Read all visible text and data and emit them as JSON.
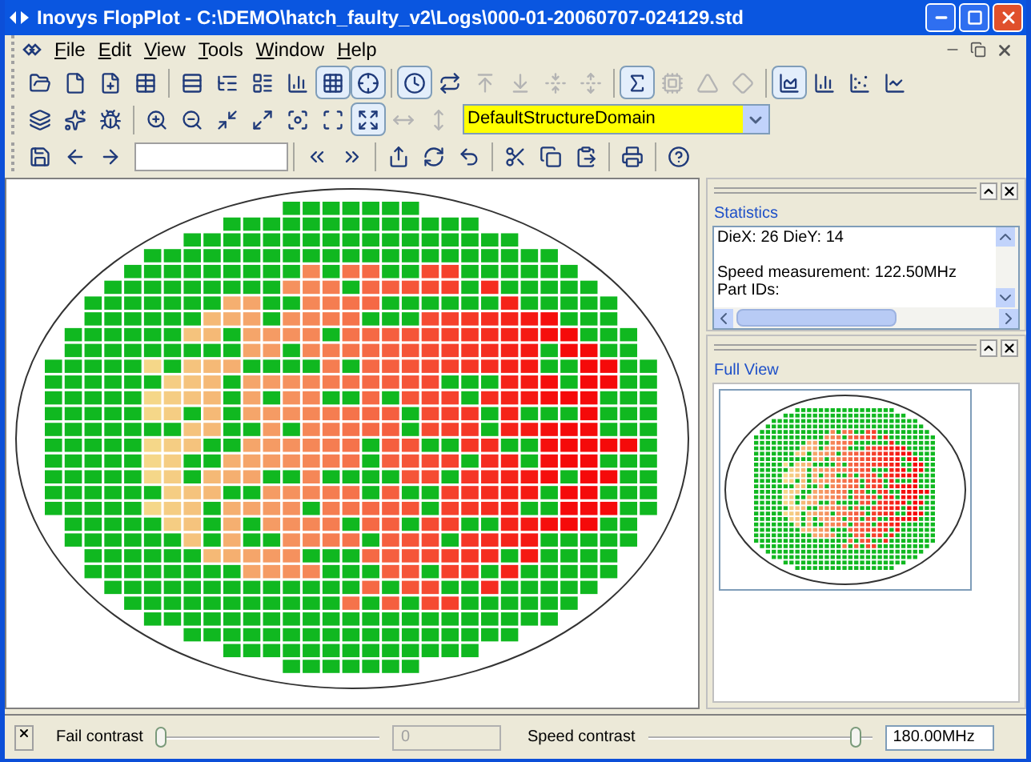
{
  "window": {
    "title": "Inovys FlopPlot - C:\\DEMO\\hatch_faulty_v2\\Logs\\000-01-20060707-024129.std"
  },
  "menu": [
    "File",
    "Edit",
    "View",
    "Tools",
    "Window",
    "Help"
  ],
  "toolbars": [
    {
      "groups": [
        [
          {
            "kind": "open",
            "pressed": false,
            "disabled": false
          },
          {
            "kind": "new",
            "pressed": false,
            "disabled": false
          },
          {
            "kind": "import",
            "pressed": false,
            "disabled": false
          },
          {
            "kind": "table",
            "pressed": false,
            "disabled": false
          }
        ],
        [
          {
            "kind": "rows",
            "pressed": false,
            "disabled": false
          },
          {
            "kind": "tree",
            "pressed": false,
            "disabled": false
          },
          {
            "kind": "list",
            "pressed": false,
            "disabled": false
          },
          {
            "kind": "bars",
            "pressed": false,
            "disabled": false
          },
          {
            "kind": "grid",
            "pressed": true,
            "disabled": false
          },
          {
            "kind": "mark",
            "pressed": true,
            "disabled": false
          }
        ],
        [
          {
            "kind": "clock",
            "pressed": true,
            "disabled": false
          },
          {
            "kind": "swap",
            "pressed": false,
            "disabled": false
          },
          {
            "kind": "top",
            "pressed": false,
            "disabled": true
          },
          {
            "kind": "bottom",
            "pressed": false,
            "disabled": true
          },
          {
            "kind": "center",
            "pressed": false,
            "disabled": true
          },
          {
            "kind": "spread",
            "pressed": false,
            "disabled": true
          }
        ],
        [
          {
            "kind": "sum",
            "pressed": true,
            "disabled": false
          },
          {
            "kind": "chip",
            "pressed": false,
            "disabled": true
          },
          {
            "kind": "triangle",
            "pressed": false,
            "disabled": true
          },
          {
            "kind": "diamond",
            "pressed": false,
            "disabled": true
          }
        ],
        [
          {
            "kind": "area",
            "pressed": true,
            "disabled": false
          },
          {
            "kind": "columns",
            "pressed": false,
            "disabled": false
          },
          {
            "kind": "scatter",
            "pressed": false,
            "disabled": false
          },
          {
            "kind": "line",
            "pressed": false,
            "disabled": false
          }
        ]
      ]
    },
    {
      "groups": [
        [
          {
            "kind": "layers",
            "pressed": false,
            "disabled": false
          },
          {
            "kind": "sparkle",
            "pressed": false,
            "disabled": false
          },
          {
            "kind": "bug",
            "pressed": false,
            "disabled": false
          }
        ],
        [
          {
            "kind": "zoomin",
            "pressed": false,
            "disabled": false
          },
          {
            "kind": "zoomout",
            "pressed": false,
            "disabled": false
          },
          {
            "kind": "shrink",
            "pressed": false,
            "disabled": false
          },
          {
            "kind": "expand",
            "pressed": false,
            "disabled": false
          },
          {
            "kind": "focus",
            "pressed": false,
            "disabled": false
          },
          {
            "kind": "fit",
            "pressed": false,
            "disabled": false
          },
          {
            "kind": "frame",
            "pressed": true,
            "disabled": false
          },
          {
            "kind": "width",
            "pressed": false,
            "disabled": true
          },
          {
            "kind": "height",
            "pressed": false,
            "disabled": true
          }
        ]
      ]
    },
    {
      "groups": [
        [
          {
            "kind": "save",
            "pressed": false,
            "disabled": false
          },
          {
            "kind": "back",
            "pressed": false,
            "disabled": false
          },
          {
            "kind": "forward",
            "pressed": false,
            "disabled": false
          }
        ],
        [
          {
            "kind": "prev",
            "pressed": false,
            "disabled": false
          },
          {
            "kind": "next",
            "pressed": false,
            "disabled": false
          }
        ],
        [
          {
            "kind": "export",
            "pressed": false,
            "disabled": false
          },
          {
            "kind": "refresh",
            "pressed": false,
            "disabled": false
          },
          {
            "kind": "undo",
            "pressed": false,
            "disabled": false
          }
        ],
        [
          {
            "kind": "cut",
            "pressed": false,
            "disabled": false
          },
          {
            "kind": "copy",
            "pressed": false,
            "disabled": false
          },
          {
            "kind": "paste",
            "pressed": false,
            "disabled": false
          }
        ],
        [
          {
            "kind": "print",
            "pressed": false,
            "disabled": false
          }
        ],
        [
          {
            "kind": "help",
            "pressed": false,
            "disabled": false
          }
        ]
      ]
    }
  ],
  "domain_select": {
    "value": "DefaultStructureDomain"
  },
  "statistics": {
    "title": "Statistics",
    "lines": [
      "DieX: 26 DieY: 14",
      "Speed measurement: 122.50MHz",
      "Part IDs:"
    ]
  },
  "full_view": {
    "title": "Full View"
  },
  "fail_contrast": {
    "label": "Fail contrast",
    "level": 0,
    "value": "0",
    "disabled": true
  },
  "speed_contrast": {
    "label": "Speed contrast",
    "level": 0.95,
    "value": "180.00MHz",
    "disabled": false
  }
}
